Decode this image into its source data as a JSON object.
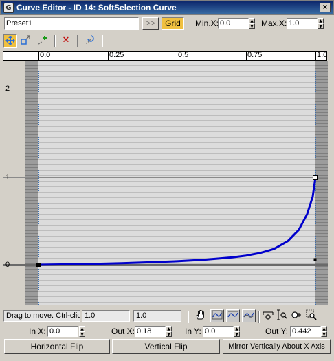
{
  "window": {
    "title": "Curve Editor - ID 14: SoftSelection Curve",
    "close_glyph": "×"
  },
  "preset": {
    "value": "Preset1",
    "arrows_glyph": "▷▷",
    "grid_label": "Grid"
  },
  "range": {
    "min_x_label": "Min.X:",
    "min_x_value": "0.0",
    "max_x_label": "Max.X:",
    "max_x_value": "1.0"
  },
  "toolbar": {
    "icons": [
      "move-icon",
      "scale-icon",
      "insert-point-icon",
      "delete-point-icon",
      "reset-curve-icon"
    ],
    "delete_glyph": "✕"
  },
  "ruler": {
    "labels": [
      "0.0",
      "0.25",
      "0.5",
      "0.75",
      "1.0"
    ]
  },
  "graph": {
    "y_labels": [
      "2",
      "1",
      "0"
    ],
    "curve_color": "#0000cc",
    "curve_points": [
      [
        0.0,
        0.0
      ],
      [
        0.1,
        0.005
      ],
      [
        0.2,
        0.01
      ],
      [
        0.3,
        0.018
      ],
      [
        0.4,
        0.028
      ],
      [
        0.5,
        0.04
      ],
      [
        0.6,
        0.058
      ],
      [
        0.7,
        0.085
      ],
      [
        0.75,
        0.105
      ],
      [
        0.8,
        0.135
      ],
      [
        0.85,
        0.18
      ],
      [
        0.9,
        0.27
      ],
      [
        0.94,
        0.4
      ],
      [
        0.97,
        0.58
      ],
      [
        0.99,
        0.78
      ],
      [
        1.0,
        1.0
      ]
    ]
  },
  "status": {
    "message": "Drag to move. Ctrl-click to add/remove",
    "value_a": "1.0",
    "value_b": "1.0",
    "tools": [
      "pan-hand-icon",
      "zoom-extents-icon",
      "zoom-horizontal-extents-icon",
      "zoom-vertical-extents-icon",
      "zoom-horizontal-icon",
      "zoom-vertical-icon",
      "zoom-icon",
      "zoom-region-icon"
    ]
  },
  "tangents": {
    "in_x_label": "In X:",
    "in_x_value": "0.0",
    "out_x_label": "Out X:",
    "out_x_value": "0.18",
    "in_y_label": "In Y:",
    "in_y_value": "0.0",
    "out_y_label": "Out Y:",
    "out_y_value": "0.442"
  },
  "buttons": {
    "horizontal_flip": "Horizontal Flip",
    "vertical_flip": "Vertical Flip",
    "mirror": "Mirror Vertically About X Axis"
  }
}
